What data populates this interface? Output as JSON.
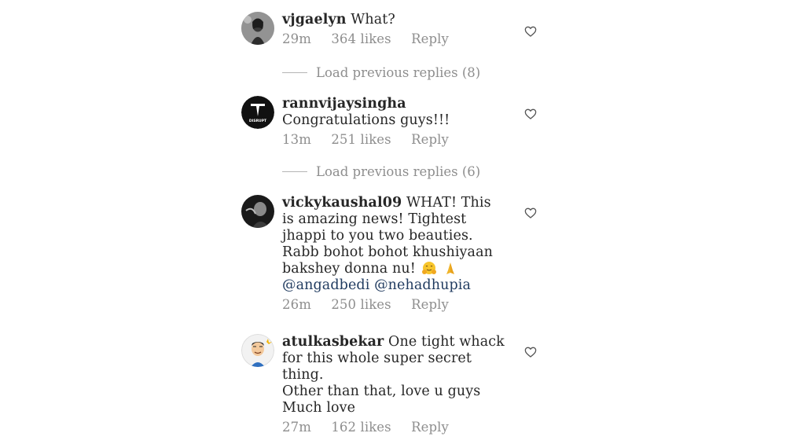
{
  "comments": [
    {
      "username": "vjgaelyn",
      "text": "What?",
      "time": "29m",
      "likes": "364 likes",
      "reply": "Reply",
      "avatar": "woman-photo-avatar"
    },
    {
      "username": "rannvijaysingha",
      "text": "Congratulations guys!!!",
      "time": "13m",
      "likes": "251 likes",
      "reply": "Reply",
      "avatar": "disrupt-logo-avatar",
      "avatar_text": "DISRUPT"
    },
    {
      "username": "vickykaushal09",
      "text_lines": [
        "WHAT! This",
        "is amazing news! Tightest",
        "jhappi to you two beauties.",
        "Rabb bohot bohot khushiyaan",
        "bakshey donna nu! "
      ],
      "emojis": [
        "hug-face-emoji",
        "folded-hands-emoji"
      ],
      "mentions": [
        "@angadbedi",
        "@nehadhupia"
      ],
      "time": "26m",
      "likes": "250 likes",
      "reply": "Reply",
      "avatar": "man-bw-photo-avatar"
    },
    {
      "username": "atulkasbekar",
      "text_lines": [
        "One tight whack",
        "for this whole super secret",
        "thing.",
        "Other than that, love u guys",
        "Much love"
      ],
      "time": "27m",
      "likes": "162 likes",
      "reply": "Reply",
      "avatar": "cartoon-man-avatar"
    }
  ],
  "load_previous": [
    "Load previous replies (8)",
    "Load previous replies (6)"
  ],
  "colors": {
    "text": "#262626",
    "meta": "#8e8e8e",
    "mention": "#1f3a5f"
  }
}
